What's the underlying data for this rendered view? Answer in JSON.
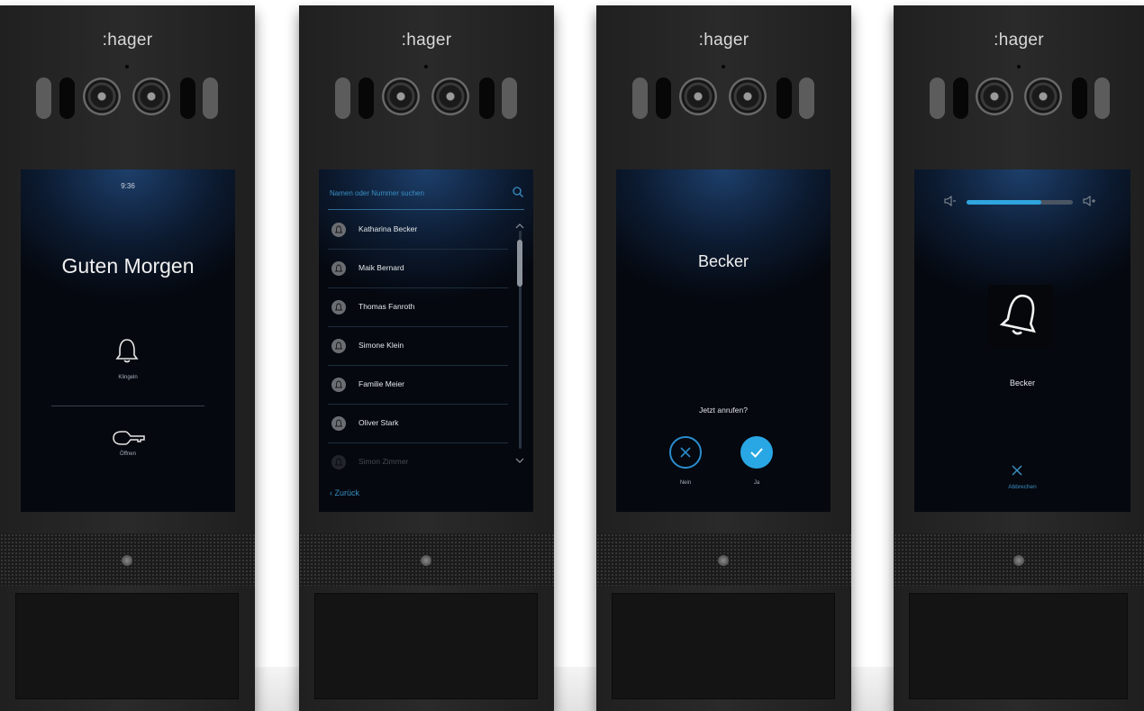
{
  "brand": ":hager",
  "screens": {
    "home": {
      "time": "9:36",
      "greeting": "Guten Morgen",
      "ring_label": "Klingeln",
      "open_label": "Öffnen"
    },
    "directory": {
      "search_placeholder": "Namen oder Nummer suchen",
      "contacts": [
        "Katharina Becker",
        "Maik Bernard",
        "Thomas Fanroth",
        "Simone Klein",
        "Familie Meier",
        "Oliver Stark",
        "Simon Zimmer"
      ],
      "back_label": "Zurück"
    },
    "confirm": {
      "callee": "Becker",
      "question": "Jetzt anrufen?",
      "no_label": "Nein",
      "yes_label": "Ja"
    },
    "calling": {
      "callee": "Becker",
      "volume_level": 0.7,
      "cancel_label": "Abbrechen"
    }
  },
  "colors": {
    "accent": "#2fa4dd",
    "screen_glow": "#1d3f6b",
    "housing": "#252525"
  }
}
